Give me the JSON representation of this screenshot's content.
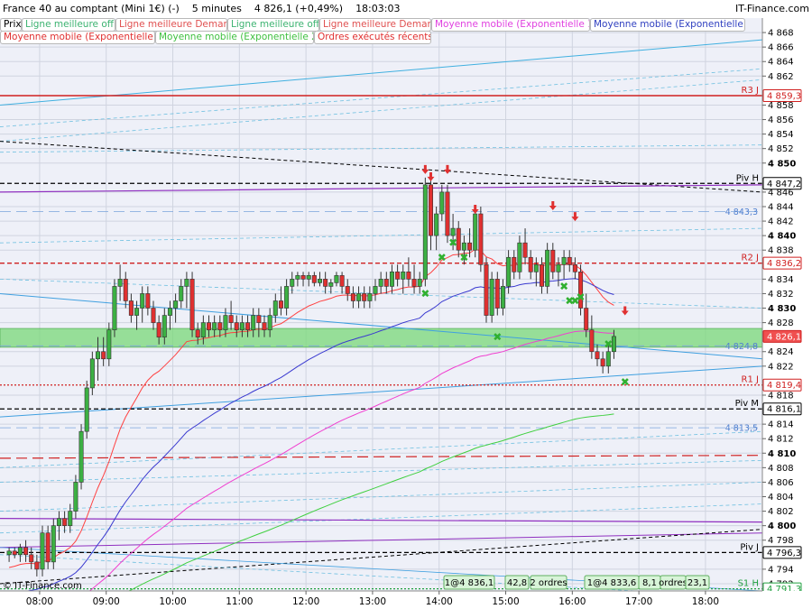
{
  "header": {
    "instrument": "France 40 au comptant (Mini 1€) (-)",
    "period": "5 minutes",
    "price": "4 826,1 (+0,49%)",
    "time": "18:03:03",
    "site": "IT-Finance.com"
  },
  "legend": [
    {
      "label": "Prix",
      "color": "#000000"
    },
    {
      "label": "Ligne meilleure offre",
      "color": "#3cb371"
    },
    {
      "label": "Ligne meilleure Demande",
      "color": "#e05050"
    },
    {
      "label": "Ligne meilleure offre",
      "color": "#3cb371"
    },
    {
      "label": "Ligne meilleure Demande",
      "color": "#e05050"
    },
    {
      "label": "Moyenne mobile (Exponentielle 100)",
      "color": "#e040e0"
    },
    {
      "label": "Moyenne mobile (Exponentielle 50)",
      "color": "#3040c0"
    },
    {
      "label": "Moyenne mobile (Exponentielle 20)",
      "color": "#e03030"
    },
    {
      "label": "Moyenne mobile (Exponentielle 200)",
      "color": "#40c040"
    },
    {
      "label": "Ordres exécutés récents",
      "color": "#e03030"
    }
  ],
  "watermark": "© IT-Finance.com",
  "colors": {
    "up": "#3cb043",
    "down": "#e03030",
    "ema20": "#ff4040",
    "ema50": "#3a3ad0",
    "ema100": "#f040d0",
    "ema200": "#40d040",
    "grid": "#d0d4e0",
    "zone": "#78d878"
  },
  "chart_data": {
    "type": "candlestick",
    "ylim": [
      4791,
      4870
    ],
    "y_ticks": [
      {
        "v": 4868,
        "t": "4 868"
      },
      {
        "v": 4866,
        "t": "4 866"
      },
      {
        "v": 4864,
        "t": "4 864"
      },
      {
        "v": 4862,
        "t": "4 862"
      },
      {
        "v": 4858,
        "t": "4 858"
      },
      {
        "v": 4856,
        "t": "4 856"
      },
      {
        "v": 4854,
        "t": "4 854"
      },
      {
        "v": 4852,
        "t": "4 852"
      },
      {
        "v": 4850,
        "t": "4 850",
        "bold": true
      },
      {
        "v": 4846,
        "t": "4 846"
      },
      {
        "v": 4844,
        "t": "4 844"
      },
      {
        "v": 4842,
        "t": "4 842"
      },
      {
        "v": 4840,
        "t": "4 840",
        "bold": true
      },
      {
        "v": 4838,
        "t": "4 838"
      },
      {
        "v": 4834,
        "t": "4 834"
      },
      {
        "v": 4832,
        "t": "4 832"
      },
      {
        "v": 4830,
        "t": "4 830",
        "bold": true
      },
      {
        "v": 4828,
        "t": "4 828"
      },
      {
        "v": 4824,
        "t": "4 824"
      },
      {
        "v": 4822,
        "t": "4 822"
      },
      {
        "v": 4818,
        "t": "4 818"
      },
      {
        "v": 4814,
        "t": "4 814"
      },
      {
        "v": 4812,
        "t": "4 812"
      },
      {
        "v": 4810,
        "t": "4 810",
        "bold": true
      },
      {
        "v": 4808,
        "t": "4 808"
      },
      {
        "v": 4806,
        "t": "4 806"
      },
      {
        "v": 4804,
        "t": "4 804"
      },
      {
        "v": 4802,
        "t": "4 802"
      },
      {
        "v": 4800,
        "t": "4 800",
        "bold": true
      },
      {
        "v": 4798,
        "t": "4 798"
      },
      {
        "v": 4794,
        "t": "4 794"
      },
      {
        "v": 4792,
        "t": "4 792"
      }
    ],
    "x_ticks": [
      {
        "t": "08:00",
        "v": 0
      },
      {
        "t": "09:00",
        "v": 12
      },
      {
        "t": "10:00",
        "v": 24
      },
      {
        "t": "11:00",
        "v": 36
      },
      {
        "t": "12:00",
        "v": 48
      },
      {
        "t": "13:00",
        "v": 60
      },
      {
        "t": "14:00",
        "v": 72
      },
      {
        "t": "15:00",
        "v": 84
      },
      {
        "t": "16:00",
        "v": 96
      },
      {
        "t": "17:00",
        "v": 108
      },
      {
        "t": "18:00",
        "v": 120
      }
    ],
    "price_tags": [
      {
        "v": 4859.3,
        "t": "4 859,3",
        "name": "R3 J",
        "color": "#d02020",
        "style": "solid"
      },
      {
        "v": 4847.2,
        "t": "4 847,2",
        "name": "Piv H",
        "color": "#000000",
        "style": "dash"
      },
      {
        "v": 4843.3,
        "t": "4 843,3",
        "name": "",
        "color": "#5080d0",
        "style": "dashlight"
      },
      {
        "v": 4836.2,
        "t": "4 836,2",
        "name": "R2 J",
        "color": "#d02020",
        "style": "dash"
      },
      {
        "v": 4826.1,
        "t": "4 826,1",
        "name": "",
        "color": "#d02020",
        "style": "none"
      },
      {
        "v": 4824.8,
        "t": "4 824,8",
        "name": "",
        "color": "#5080d0",
        "style": "dashlight"
      },
      {
        "v": 4819.4,
        "t": "4 819,4",
        "name": "R1 J",
        "color": "#d02020",
        "style": "dot"
      },
      {
        "v": 4816.1,
        "t": "4 816,1",
        "name": "Piv M",
        "color": "#000000",
        "style": "dash"
      },
      {
        "v": 4813.5,
        "t": "4 813,5",
        "name": "",
        "color": "#5080d0",
        "style": "dashlight"
      },
      {
        "v": 4796.3,
        "t": "4 796,3",
        "name": "Piv J",
        "color": "#000000",
        "style": "dash"
      },
      {
        "v": 4791.3,
        "t": "4 791,3",
        "name": "S1 H",
        "color": "#20a040",
        "style": "dot"
      }
    ],
    "bottom_boxes": [
      "1@4 836,1",
      "42,8",
      "2 ordres",
      "1@4 833,6",
      "8,1",
      "ordres",
      "23,1"
    ],
    "candles": [
      [
        4796,
        4797,
        4795,
        4796.5
      ],
      [
        4796.5,
        4797,
        4795.5,
        4796
      ],
      [
        4796,
        4797.5,
        4795,
        4797
      ],
      [
        4797,
        4798,
        4795,
        4796
      ],
      [
        4796,
        4797,
        4794,
        4795
      ],
      [
        4795,
        4796,
        4793,
        4794
      ],
      [
        4794,
        4800,
        4793,
        4799
      ],
      [
        4799,
        4800,
        4794,
        4795
      ],
      [
        4795,
        4801,
        4794,
        4800
      ],
      [
        4800,
        4802,
        4798,
        4801
      ],
      [
        4801,
        4802,
        4799,
        4800
      ],
      [
        4800,
        4803,
        4799,
        4802
      ],
      [
        4802,
        4807,
        4801,
        4806
      ],
      [
        4806,
        4814,
        4805,
        4813
      ],
      [
        4813,
        4820,
        4812,
        4819
      ],
      [
        4819,
        4824,
        4818,
        4823
      ],
      [
        4823,
        4826,
        4820,
        4824
      ],
      [
        4824,
        4826,
        4822,
        4823
      ],
      [
        4823,
        4828,
        4822,
        4827
      ],
      [
        4827,
        4834,
        4826,
        4833
      ],
      [
        4833,
        4836,
        4831,
        4834
      ],
      [
        4834,
        4835,
        4830,
        4831
      ],
      [
        4831,
        4832,
        4828,
        4829
      ],
      [
        4829,
        4831,
        4827,
        4830
      ],
      [
        4830,
        4833,
        4828,
        4832
      ],
      [
        4832,
        4833,
        4829,
        4830
      ],
      [
        4830,
        4831,
        4827,
        4828
      ],
      [
        4828,
        4829,
        4825,
        4826
      ],
      [
        4826,
        4830,
        4825,
        4829
      ],
      [
        4829,
        4831,
        4827,
        4830
      ],
      [
        4830,
        4832,
        4828,
        4831
      ],
      [
        4831,
        4834,
        4830,
        4833
      ],
      [
        4833,
        4835,
        4830,
        4834
      ],
      [
        4834,
        4835,
        4826,
        4827
      ],
      [
        4827,
        4828,
        4825,
        4826
      ],
      [
        4826,
        4829,
        4825,
        4828
      ],
      [
        4828,
        4829,
        4826,
        4827
      ],
      [
        4827,
        4829,
        4826,
        4828
      ],
      [
        4828,
        4829,
        4826,
        4827
      ],
      [
        4827,
        4830,
        4826,
        4829
      ],
      [
        4829,
        4831,
        4827,
        4828
      ],
      [
        4828,
        4829,
        4826,
        4827
      ],
      [
        4827,
        4829,
        4826,
        4828
      ],
      [
        4828,
        4829,
        4826,
        4827
      ],
      [
        4827,
        4830,
        4826,
        4829
      ],
      [
        4829,
        4830,
        4826,
        4828
      ],
      [
        4828,
        4829,
        4826,
        4827
      ],
      [
        4827,
        4830,
        4826,
        4829
      ],
      [
        4829,
        4832,
        4828,
        4831
      ],
      [
        4831,
        4833,
        4829,
        4830
      ],
      [
        4830,
        4834,
        4829,
        4833
      ],
      [
        4833,
        4835,
        4832,
        4834
      ],
      [
        4834,
        4835,
        4833,
        4834.5
      ],
      [
        4834.5,
        4835,
        4833,
        4834
      ],
      [
        4834,
        4835,
        4833,
        4834.5
      ],
      [
        4834.5,
        4835,
        4833,
        4833.5
      ],
      [
        4833.5,
        4835,
        4833,
        4834
      ],
      [
        4834,
        4835,
        4832,
        4833
      ],
      [
        4833,
        4834,
        4832,
        4833.5
      ],
      [
        4833.5,
        4835,
        4833,
        4834.5
      ],
      [
        4834.5,
        4835,
        4832,
        4833
      ],
      [
        4833,
        4834,
        4831,
        4832
      ],
      [
        4832,
        4833,
        4830,
        4831
      ],
      [
        4831,
        4833,
        4830,
        4832
      ],
      [
        4832,
        4833,
        4830,
        4831
      ],
      [
        4831,
        4833,
        4830,
        4832
      ],
      [
        4832,
        4834,
        4831,
        4833
      ],
      [
        4833,
        4835,
        4832,
        4834
      ],
      [
        4834,
        4835,
        4832,
        4833
      ],
      [
        4833,
        4836,
        4832,
        4835
      ],
      [
        4835,
        4836,
        4833,
        4834
      ],
      [
        4834,
        4836,
        4832,
        4835
      ],
      [
        4835,
        4837,
        4833,
        4834
      ],
      [
        4834,
        4836,
        4832,
        4833
      ],
      [
        4833,
        4835,
        4832,
        4834
      ],
      [
        4834,
        4848,
        4833,
        4847
      ],
      [
        4847,
        4848,
        4838,
        4840
      ],
      [
        4840,
        4844,
        4838,
        4843
      ],
      [
        4843,
        4847,
        4842,
        4846
      ],
      [
        4846,
        4847,
        4839,
        4840
      ],
      [
        4840,
        4843,
        4838,
        4841
      ],
      [
        4841,
        4842,
        4837,
        4838
      ],
      [
        4838,
        4840,
        4836,
        4839
      ],
      [
        4839,
        4841,
        4837,
        4838
      ],
      [
        4838,
        4844,
        4837,
        4843
      ],
      [
        4843,
        4844,
        4835,
        4836
      ],
      [
        4836,
        4837,
        4828,
        4829
      ],
      [
        4829,
        4835,
        4828,
        4834
      ],
      [
        4834,
        4835,
        4829,
        4830
      ],
      [
        4830,
        4834,
        4829,
        4833
      ],
      [
        4833,
        4838,
        4832,
        4837
      ],
      [
        4837,
        4838,
        4834,
        4835
      ],
      [
        4835,
        4840,
        4834,
        4839
      ],
      [
        4839,
        4841,
        4836,
        4837
      ],
      [
        4837,
        4838,
        4834,
        4835
      ],
      [
        4835,
        4837,
        4833,
        4836
      ],
      [
        4836,
        4837,
        4832,
        4833
      ],
      [
        4833,
        4839,
        4832,
        4838
      ],
      [
        4838,
        4839,
        4834,
        4835
      ],
      [
        4835,
        4837,
        4833,
        4836
      ],
      [
        4836,
        4838,
        4834,
        4837
      ],
      [
        4837,
        4838,
        4835,
        4836
      ],
      [
        4836,
        4837,
        4834,
        4835
      ],
      [
        4835,
        4836,
        4829,
        4830
      ],
      [
        4830,
        4832,
        4826,
        4827
      ],
      [
        4827,
        4829,
        4823,
        4824
      ],
      [
        4824,
        4825,
        4822,
        4823
      ],
      [
        4823,
        4824,
        4821,
        4822
      ],
      [
        4822,
        4825,
        4821,
        4824
      ],
      [
        4824,
        4827,
        4823,
        4826.1
      ]
    ]
  }
}
